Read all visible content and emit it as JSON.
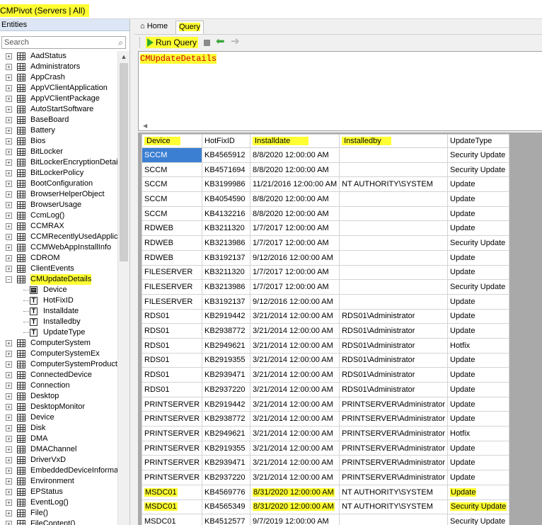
{
  "window": {
    "title": "CMPivot (Servers | All)"
  },
  "entities": {
    "header": "Entities",
    "search_placeholder": "Search",
    "tree": [
      "AadStatus",
      "Administrators",
      "AppCrash",
      "AppVClientApplication",
      "AppVClientPackage",
      "AutoStartSoftware",
      "BaseBoard",
      "Battery",
      "Bios",
      "BitLocker",
      "BitLockerEncryptionDetails",
      "BitLockerPolicy",
      "BootConfiguration",
      "BrowserHelperObject",
      "BrowserUsage",
      "CcmLog()",
      "CCMRAX",
      "CCMRecentlyUsedApplica",
      "CCMWebAppInstallInfo",
      "CDROM",
      "ClientEvents",
      "CMUpdateDetails"
    ],
    "expanded_children": [
      "Device",
      "HotFixID",
      "Installdate",
      "Installedby",
      "UpdateType"
    ],
    "tree_after": [
      "ComputerSystem",
      "ComputerSystemEx",
      "ComputerSystemProduct",
      "ConnectedDevice",
      "Connection",
      "Desktop",
      "DesktopMonitor",
      "Device",
      "Disk",
      "DMA",
      "DMAChannel",
      "DriverVxD",
      "EmbeddedDeviceInformati",
      "Environment",
      "EPStatus",
      "EventLog()",
      "File()",
      "FileContent()"
    ]
  },
  "tabs": {
    "home": "Home",
    "query": "Query"
  },
  "toolbar": {
    "run_query": "Run Query"
  },
  "query": {
    "text": "CMUpdateDetails"
  },
  "results": {
    "columns": [
      "Device",
      "HotFixID",
      "Installdate",
      "Installedby",
      "UpdateType"
    ],
    "rows": [
      [
        "SCCM",
        "KB4565912",
        "8/8/2020 12:00:00 AM",
        "",
        "Security Update"
      ],
      [
        "SCCM",
        "KB4571694",
        "8/8/2020 12:00:00 AM",
        "",
        "Security Update"
      ],
      [
        "SCCM",
        "KB3199986",
        "11/21/2016 12:00:00 AM",
        "NT AUTHORITY\\SYSTEM",
        "Update"
      ],
      [
        "SCCM",
        "KB4054590",
        "8/8/2020 12:00:00 AM",
        "",
        "Update"
      ],
      [
        "SCCM",
        "KB4132216",
        "8/8/2020 12:00:00 AM",
        "",
        "Update"
      ],
      [
        "RDWEB",
        "KB3211320",
        "1/7/2017 12:00:00 AM",
        "",
        "Update"
      ],
      [
        "RDWEB",
        "KB3213986",
        "1/7/2017 12:00:00 AM",
        "",
        "Security Update"
      ],
      [
        "RDWEB",
        "KB3192137",
        "9/12/2016 12:00:00 AM",
        "",
        "Update"
      ],
      [
        "FILESERVER",
        "KB3211320",
        "1/7/2017 12:00:00 AM",
        "",
        "Update"
      ],
      [
        "FILESERVER",
        "KB3213986",
        "1/7/2017 12:00:00 AM",
        "",
        "Security Update"
      ],
      [
        "FILESERVER",
        "KB3192137",
        "9/12/2016 12:00:00 AM",
        "",
        "Update"
      ],
      [
        "RDS01",
        "KB2919442",
        "3/21/2014 12:00:00 AM",
        "RDS01\\Administrator",
        "Update"
      ],
      [
        "RDS01",
        "KB2938772",
        "3/21/2014 12:00:00 AM",
        "RDS01\\Administrator",
        "Update"
      ],
      [
        "RDS01",
        "KB2949621",
        "3/21/2014 12:00:00 AM",
        "RDS01\\Administrator",
        "Hotfix"
      ],
      [
        "RDS01",
        "KB2919355",
        "3/21/2014 12:00:00 AM",
        "RDS01\\Administrator",
        "Update"
      ],
      [
        "RDS01",
        "KB2939471",
        "3/21/2014 12:00:00 AM",
        "RDS01\\Administrator",
        "Update"
      ],
      [
        "RDS01",
        "KB2937220",
        "3/21/2014 12:00:00 AM",
        "RDS01\\Administrator",
        "Update"
      ],
      [
        "PRINTSERVER",
        "KB2919442",
        "3/21/2014 12:00:00 AM",
        "PRINTSERVER\\Administrator",
        "Update"
      ],
      [
        "PRINTSERVER",
        "KB2938772",
        "3/21/2014 12:00:00 AM",
        "PRINTSERVER\\Administrator",
        "Update"
      ],
      [
        "PRINTSERVER",
        "KB2949621",
        "3/21/2014 12:00:00 AM",
        "PRINTSERVER\\Administrator",
        "Hotfix"
      ],
      [
        "PRINTSERVER",
        "KB2919355",
        "3/21/2014 12:00:00 AM",
        "PRINTSERVER\\Administrator",
        "Update"
      ],
      [
        "PRINTSERVER",
        "KB2939471",
        "3/21/2014 12:00:00 AM",
        "PRINTSERVER\\Administrator",
        "Update"
      ],
      [
        "PRINTSERVER",
        "KB2937220",
        "3/21/2014 12:00:00 AM",
        "PRINTSERVER\\Administrator",
        "Update"
      ],
      [
        "MSDC01",
        "KB4569776",
        "8/31/2020 12:00:00 AM",
        "NT AUTHORITY\\SYSTEM",
        "Update"
      ],
      [
        "MSDC01",
        "KB4565349",
        "8/31/2020 12:00:00 AM",
        "NT AUTHORITY\\SYSTEM",
        "Security Update"
      ],
      [
        "MSDC01",
        "KB4512577",
        "9/7/2019 12:00:00 AM",
        "",
        "Security Update"
      ]
    ]
  },
  "colors": {
    "highlight": "#ffff33",
    "selection": "#3b7fd2",
    "query_text": "#cc0000",
    "run_icon": "#2eaa2e"
  }
}
